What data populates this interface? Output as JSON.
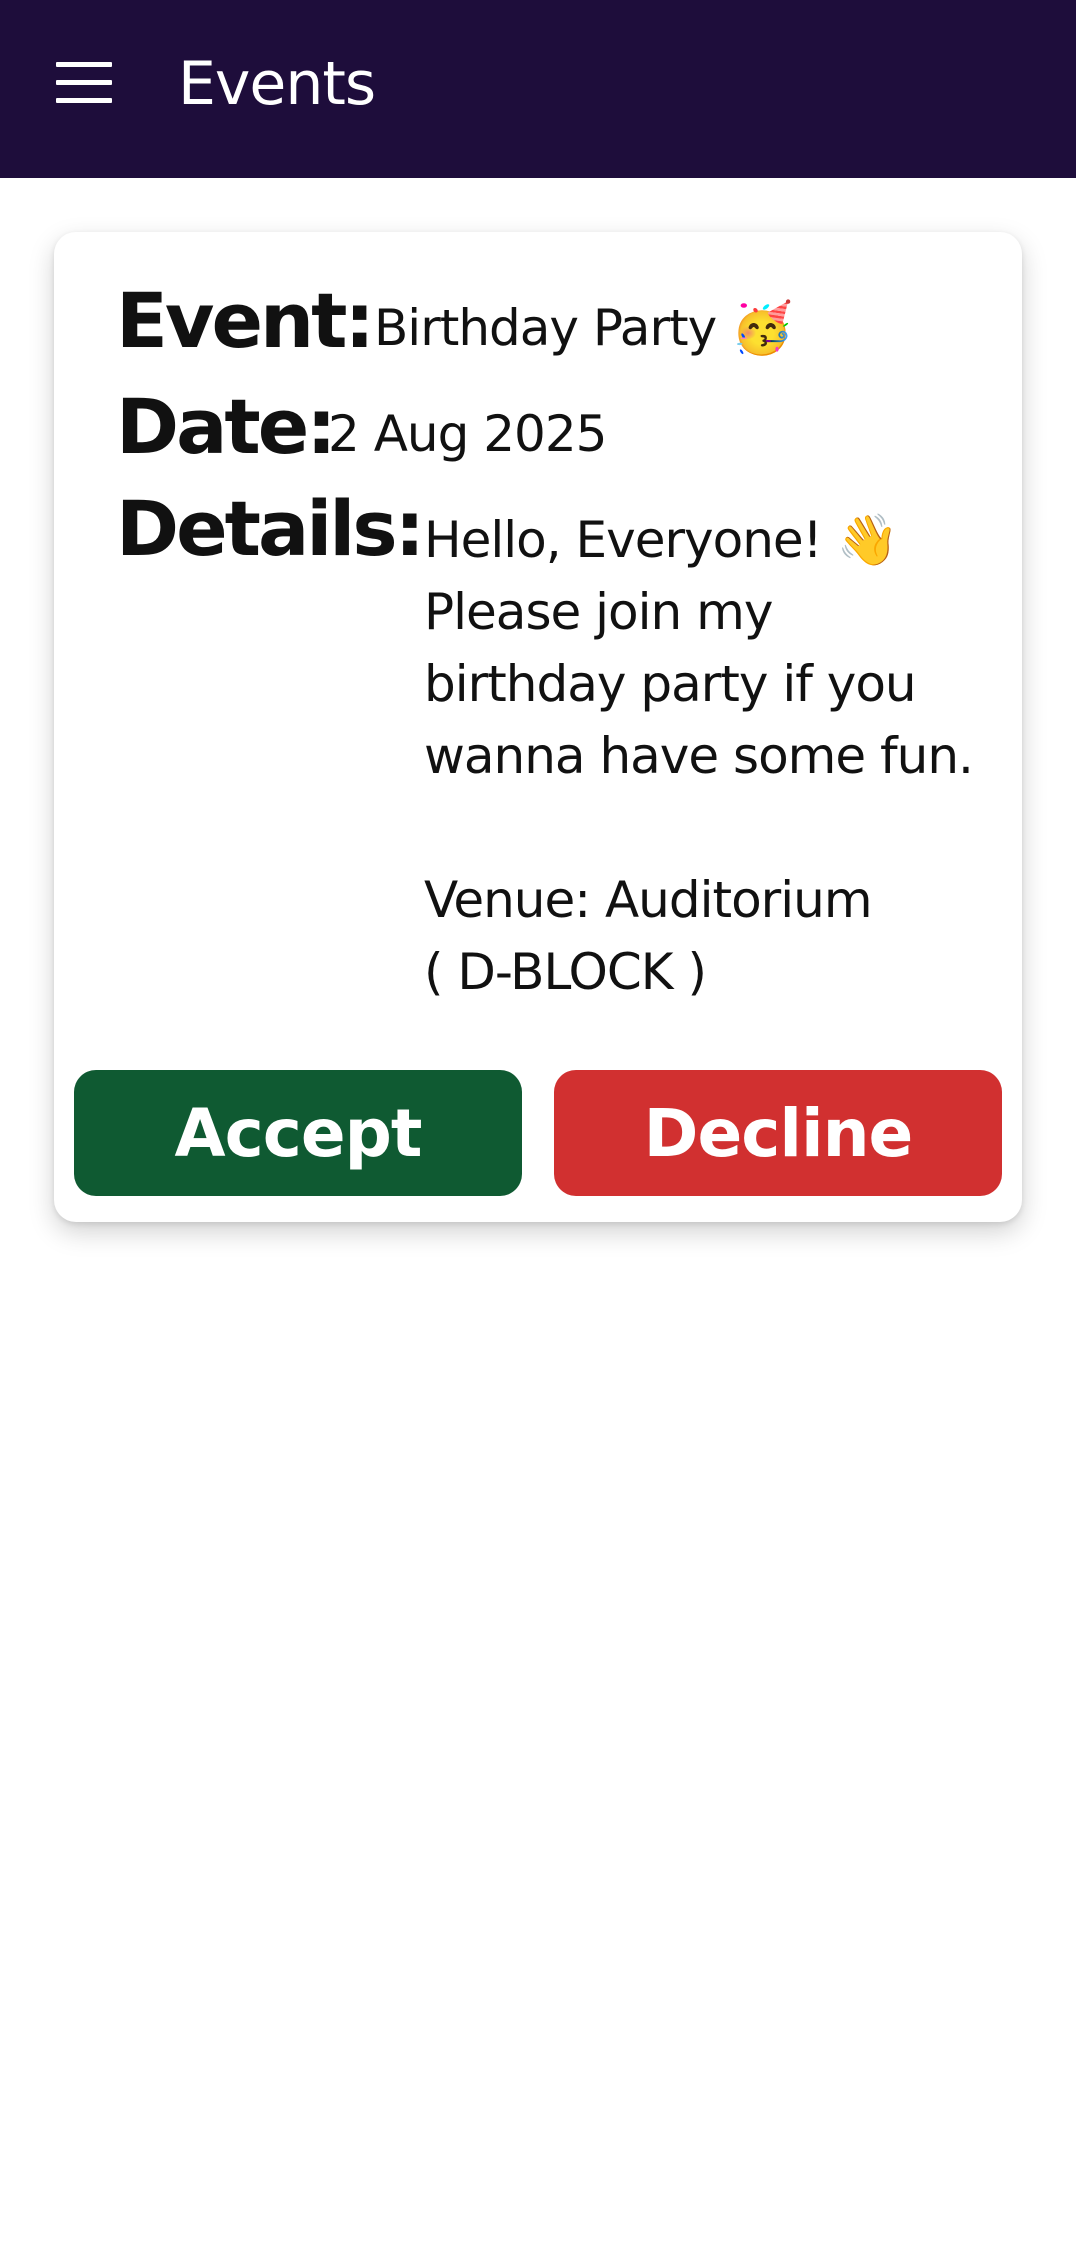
{
  "app_bar": {
    "title": "Events",
    "menu_icon": "hamburger-menu-icon",
    "background_color": "#1e0d3b"
  },
  "event_card": {
    "event_label": "Event:",
    "event_value": "Birthday Party 🥳",
    "date_label": "Date:",
    "date_value": "2 Aug 2025",
    "details_label": "Details:",
    "details_value": "Hello, Everyone! 👋\nPlease join my\nbirthday party if you\nwanna have some fun.\n\nVenue: Auditorium\n( D-BLOCK )",
    "accept_label": "Accept",
    "decline_label": "Decline",
    "accept_color": "#0f5a32",
    "decline_color": "#d13030"
  }
}
